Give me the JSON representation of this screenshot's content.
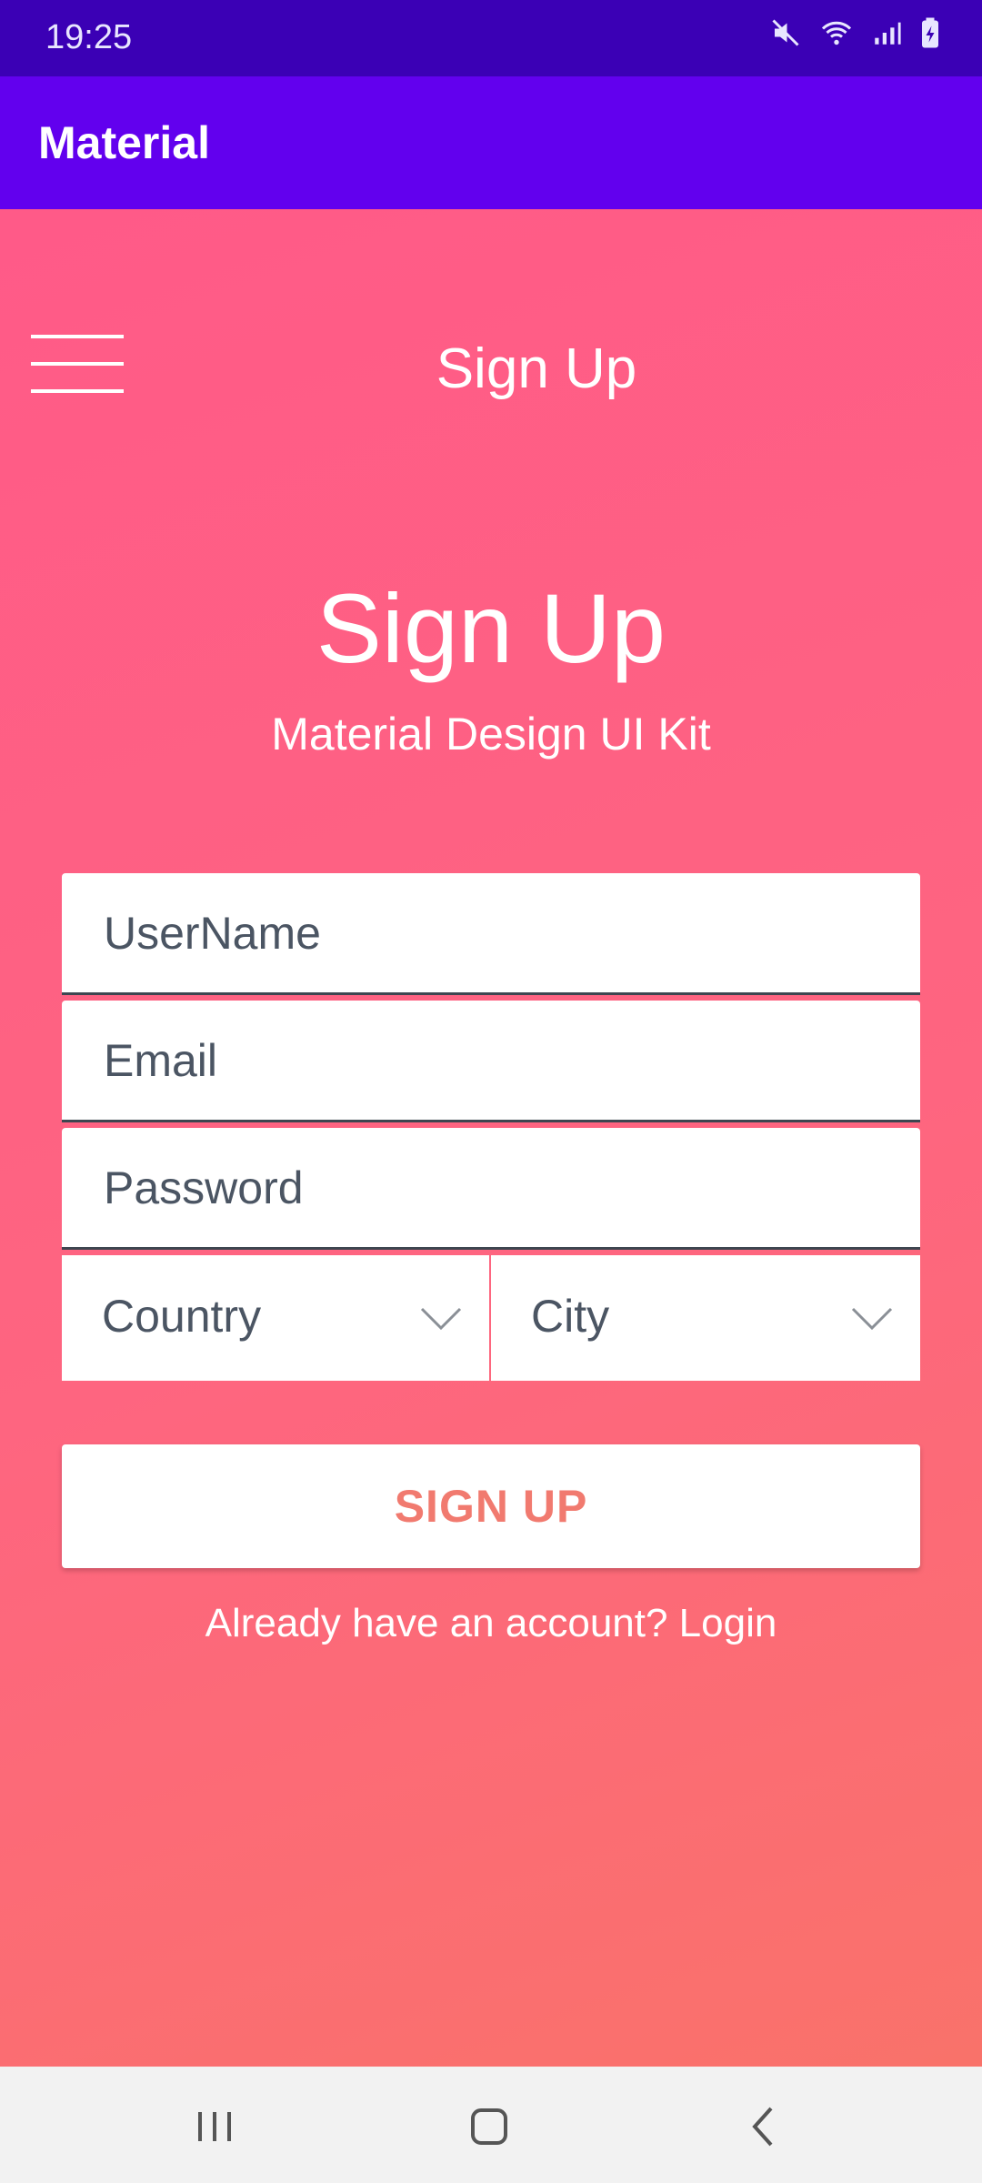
{
  "status_bar": {
    "time": "19:25",
    "icons": [
      "mute-icon",
      "wifi-icon",
      "signal-icon",
      "battery-icon"
    ]
  },
  "app_bar": {
    "title": "Material"
  },
  "toolbar": {
    "title": "Sign Up"
  },
  "header": {
    "title": "Sign Up",
    "subtitle": "Material Design UI Kit"
  },
  "form": {
    "username_placeholder": "UserName",
    "email_placeholder": "Email",
    "password_placeholder": "Password",
    "country_value": "Country",
    "city_value": "City"
  },
  "actions": {
    "signup_label": "SIGN UP",
    "login_text": "Already have an account? Login"
  },
  "nav_bar": {
    "buttons": [
      "recents-icon",
      "home-icon",
      "back-icon"
    ]
  },
  "colors": {
    "status_bar": "#3b00b5",
    "app_bar": "#6200ee",
    "gradient_top": "#ff5a88",
    "gradient_bottom": "#f9726a",
    "button_text": "#f17a6f"
  }
}
